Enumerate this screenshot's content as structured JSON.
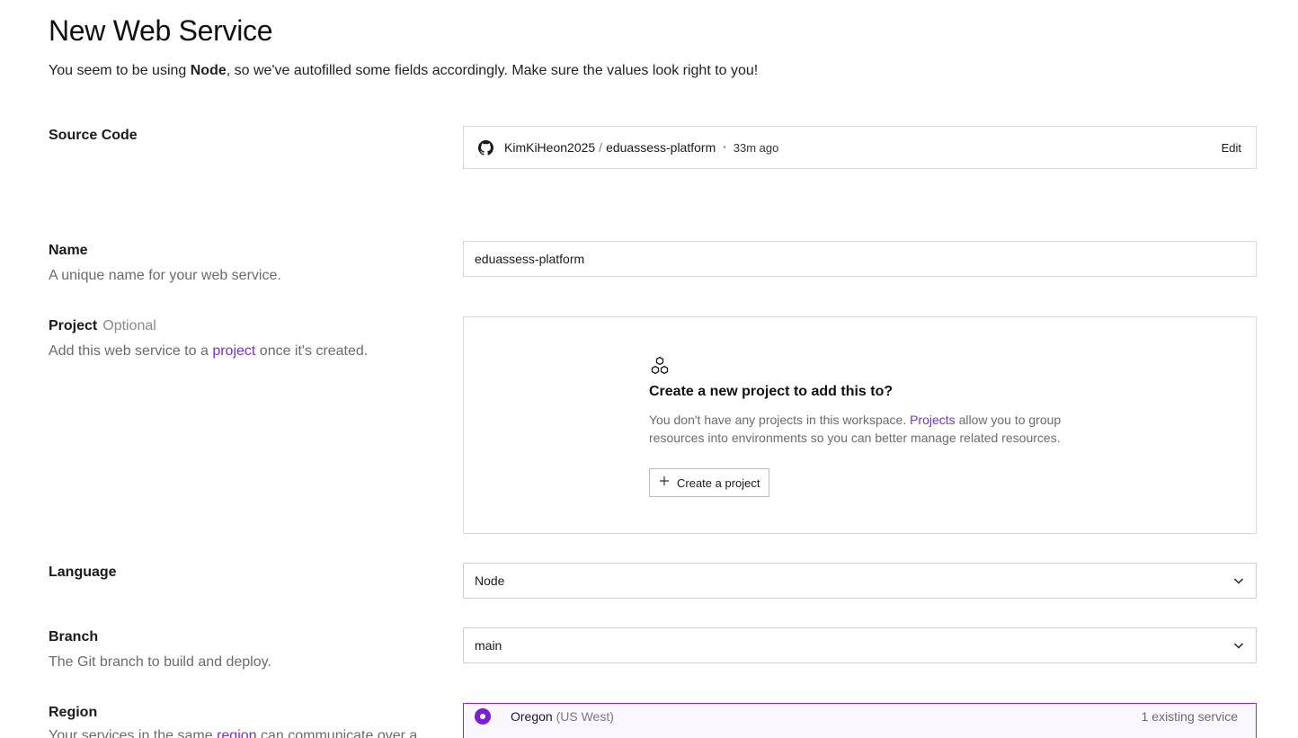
{
  "header": {
    "title": "New Web Service",
    "subtitle_pre": "You seem to be using ",
    "subtitle_bold": "Node",
    "subtitle_post": ", so we've autofilled some fields accordingly. Make sure the values look right to you!"
  },
  "source_code": {
    "label": "Source Code",
    "owner": "KimKiHeon2025",
    "separator": "/",
    "repo": "eduassess-platform",
    "dot": "•",
    "time": "33m ago",
    "edit_label": "Edit",
    "icon": "github-icon"
  },
  "name": {
    "label": "Name",
    "description": "A unique name for your web service.",
    "value": "eduassess-platform"
  },
  "project": {
    "label": "Project",
    "optional_label": "Optional",
    "desc_pre": "Add this web service to a ",
    "desc_link": "project",
    "desc_post": " once it's created.",
    "empty_title": "Create a new project to add this to?",
    "empty_text_pre": "You don't have any projects in this workspace. ",
    "empty_text_link": "Projects",
    "empty_text_post": " allow you to group resources into environments so you can better manage related resources.",
    "create_button": "Create a project",
    "icon": "projects-icon"
  },
  "language": {
    "label": "Language",
    "selected": "Node"
  },
  "branch": {
    "label": "Branch",
    "description": "The Git branch to build and deploy.",
    "selected": "main"
  },
  "region": {
    "label": "Region",
    "desc_pre": "Your services in the same ",
    "desc_link": "region",
    "desc_post": " can communicate over a",
    "option_name": "Oregon",
    "option_sub": "(US West)",
    "option_count": "1 existing service"
  },
  "colors": {
    "accent": "#7b2cdb",
    "border": "#d9d9d9",
    "muted_text": "#6b6b6b"
  }
}
